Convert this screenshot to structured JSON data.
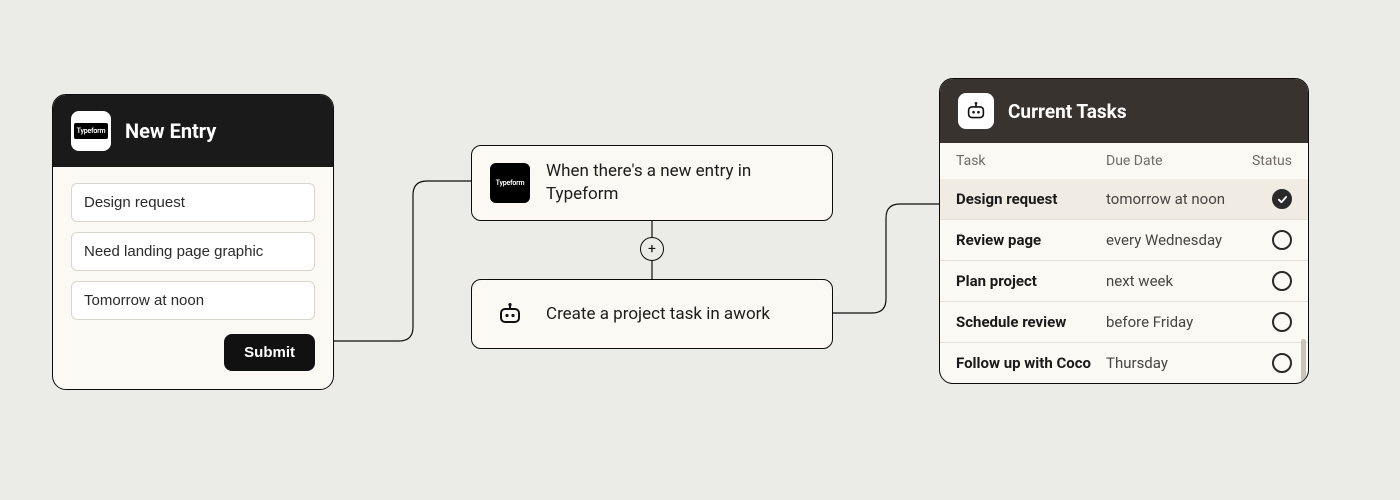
{
  "entry": {
    "title": "New Entry",
    "fields": [
      {
        "value": "Design request"
      },
      {
        "value": "Need landing page graphic"
      },
      {
        "value": "Tomorrow at noon"
      }
    ],
    "submit_label": "Submit",
    "logo_label": "Typeform"
  },
  "flow": {
    "trigger": {
      "label": "When there's a new entry in Typeform",
      "icon_label": "Typeform"
    },
    "plus": "+",
    "action": {
      "label": "Create a project task in awork"
    }
  },
  "tasks": {
    "title": "Current Tasks",
    "columns": {
      "task": "Task",
      "due": "Due Date",
      "status": "Status"
    },
    "rows": [
      {
        "name": "Design request",
        "due": "tomorrow at noon",
        "done": true,
        "highlight": true
      },
      {
        "name": "Review page",
        "due": "every Wednesday",
        "done": false,
        "highlight": false
      },
      {
        "name": "Plan project",
        "due": "next week",
        "done": false,
        "highlight": false
      },
      {
        "name": "Schedule review",
        "due": "before Friday",
        "done": false,
        "highlight": false
      },
      {
        "name": "Follow up with Coco",
        "due": "Thursday",
        "done": false,
        "highlight": false
      }
    ]
  }
}
